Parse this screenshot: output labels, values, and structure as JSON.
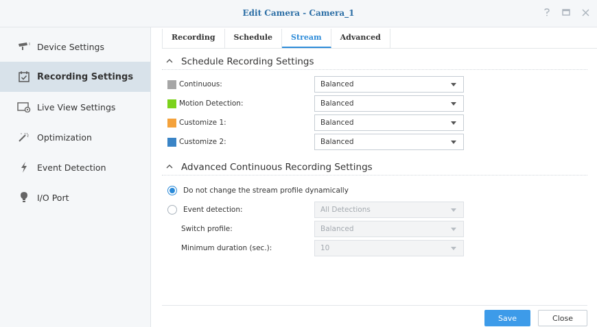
{
  "window": {
    "title": "Edit Camera - Camera_1"
  },
  "sidebar": {
    "items": [
      {
        "label": "Device Settings",
        "icon": "camera-icon"
      },
      {
        "label": "Recording Settings",
        "icon": "calendar-check-icon",
        "active": true
      },
      {
        "label": "Live View Settings",
        "icon": "live-view-icon"
      },
      {
        "label": "Optimization",
        "icon": "magic-wand-icon"
      },
      {
        "label": "Event Detection",
        "icon": "lightning-icon"
      },
      {
        "label": "I/O Port",
        "icon": "lightbulb-icon"
      }
    ]
  },
  "tabs": [
    {
      "label": "Recording"
    },
    {
      "label": "Schedule"
    },
    {
      "label": "Stream",
      "active": true
    },
    {
      "label": "Advanced"
    }
  ],
  "schedule_section": {
    "title": "Schedule Recording Settings",
    "rows": [
      {
        "label": "Continuous:",
        "color": "#a6a6a6",
        "value": "Balanced"
      },
      {
        "label": "Motion Detection:",
        "color": "#7cd21c",
        "value": "Balanced"
      },
      {
        "label": "Customize 1:",
        "color": "#f4a23b",
        "value": "Balanced"
      },
      {
        "label": "Customize 2:",
        "color": "#3a84c6",
        "value": "Balanced"
      }
    ]
  },
  "advanced_section": {
    "title": "Advanced Continuous Recording Settings",
    "option_static": "Do not change the stream profile dynamically",
    "option_event": "Event detection:",
    "event_value": "All Detections",
    "switch_label": "Switch profile:",
    "switch_value": "Balanced",
    "duration_label": "Minimum duration (sec.):",
    "duration_value": "10"
  },
  "footer": {
    "save": "Save",
    "close": "Close"
  },
  "colors": {
    "accent": "#2b8ad8",
    "save_button": "#3d9be9"
  }
}
